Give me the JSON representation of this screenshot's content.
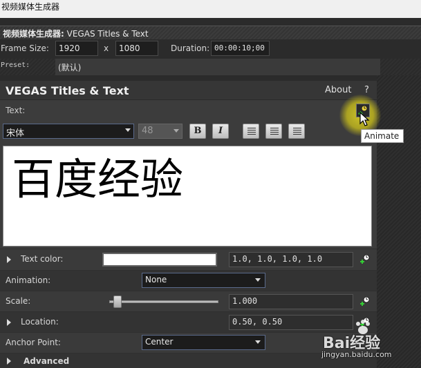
{
  "window": {
    "title": "视频媒体生成器"
  },
  "generator": {
    "header_cn": "视频媒体生成器:",
    "header_plugin": "VEGAS Titles & Text",
    "frame_size_label": "Frame Size:",
    "width": "1920",
    "x_label": "x",
    "height": "1080",
    "duration_label": "Duration:",
    "duration": "00:00:10;00",
    "preset_label": "Preset:",
    "preset_value": "(默认)"
  },
  "panel": {
    "title": "VEGAS Titles & Text",
    "about": "About",
    "help": "?",
    "text_label": "Text:",
    "animate_tooltip": "Animate",
    "font": "宋体",
    "size": "48",
    "bold": "B",
    "italic": "I",
    "content": "百度经验"
  },
  "properties": {
    "text_color": {
      "label": "Text color:",
      "value": "1.0, 1.0, 1.0, 1.0"
    },
    "animation": {
      "label": "Animation:",
      "value": "None"
    },
    "scale": {
      "label": "Scale:",
      "value": "1.000"
    },
    "location": {
      "label": "Location:",
      "value": "0.50, 0.50"
    },
    "anchor": {
      "label": "Anchor Point:",
      "value": "Center"
    },
    "advanced": {
      "label": "Advanced"
    }
  },
  "watermark": {
    "brand": "Bai经验",
    "url": "jingyan.baidu.com"
  },
  "colors": {
    "highlight": "#d2c828",
    "text_area": "#ffffff",
    "panel_bg": "#3c3c3c"
  },
  "icons": [
    "keyframe-icon",
    "bold-icon",
    "italic-icon",
    "align-left-icon",
    "align-center-icon",
    "align-right-icon",
    "cursor-icon"
  ]
}
